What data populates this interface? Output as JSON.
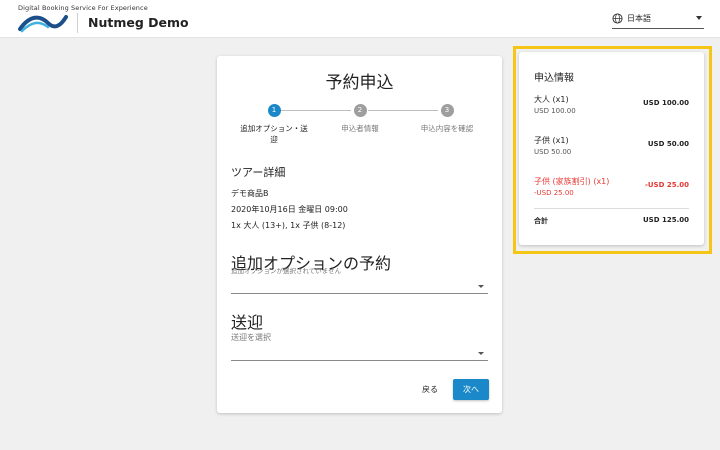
{
  "header": {
    "tagline": "Digital Booking Service For Experience",
    "brand": "Nutmeg Demo",
    "logo_icon": "wave-logo-icon",
    "language": "日本語",
    "language_icon": "globe-icon"
  },
  "booking": {
    "title": "予約申込",
    "steps": [
      {
        "number": "1",
        "label": "追加オプション・送迎",
        "state": "active"
      },
      {
        "number": "2",
        "label": "申込者情報",
        "state": "inactive"
      },
      {
        "number": "3",
        "label": "申込内容を確認",
        "state": "inactive"
      }
    ],
    "tour_section_title": "ツアー詳細",
    "product_name": "デモ商品B",
    "datetime": "2020年10月16日 金曜日 09:00",
    "participants": "1x 大人 (13+), 1x 子供 (8-12)",
    "addon_section_title": "追加オプションの予約",
    "addon_hint": "追加オプションが選択されていません",
    "transfer_section_title": "送迎",
    "transfer_placeholder": "送迎を選択",
    "back_label": "戻る",
    "next_label": "次へ"
  },
  "summary": {
    "title": "申込情報",
    "items": [
      {
        "name": "大人 (x1)",
        "sub": "USD 100.00",
        "amount": "USD 100.00"
      },
      {
        "name": "子供 (x1)",
        "sub": "USD 50.00",
        "amount": "USD 50.00"
      },
      {
        "name": "子供 (家族割引) (x1)",
        "sub": "-USD 25.00",
        "amount": "-USD 25.00"
      }
    ],
    "total_label": "合計",
    "total_amount": "USD 125.00"
  },
  "colors": {
    "primary": "#1a88c9",
    "discount": "#e53935",
    "highlight": "#f5c518"
  }
}
